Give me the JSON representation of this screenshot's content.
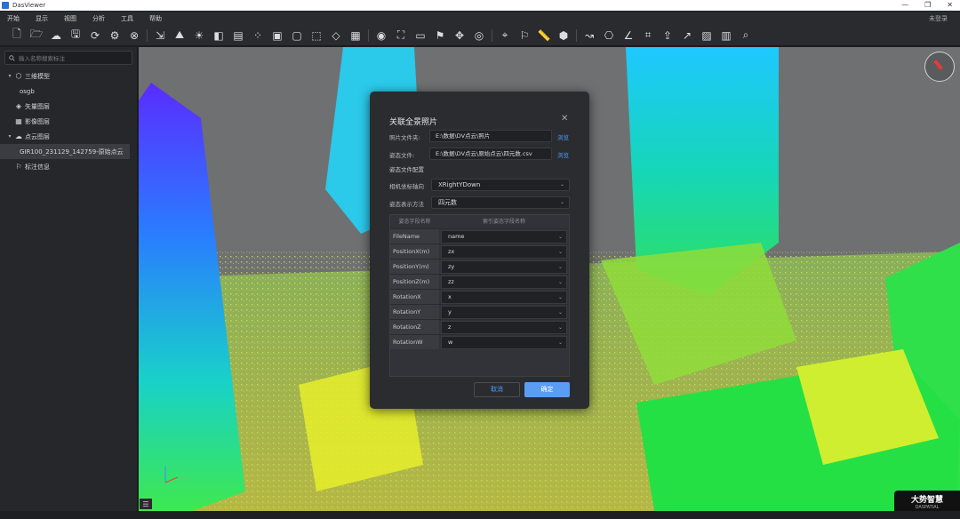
{
  "window": {
    "title": "DasViewer",
    "controls": [
      "—",
      "❐",
      "✕"
    ]
  },
  "menu": {
    "items": [
      "开始",
      "显示",
      "视图",
      "分析",
      "工具",
      "帮助"
    ],
    "login": "未登录"
  },
  "sidebar": {
    "search_placeholder": "输入名称搜索标注",
    "items": [
      {
        "label": "三维模型",
        "icon": "cube-icon",
        "chevron": "▾",
        "indent": 0
      },
      {
        "label": "osgb",
        "icon": "",
        "chevron": "",
        "indent": 1
      },
      {
        "label": "矢量图层",
        "icon": "layers-icon",
        "chevron": "",
        "indent": 0
      },
      {
        "label": "影像图层",
        "icon": "map-icon",
        "chevron": "",
        "indent": 0
      },
      {
        "label": "点云图层",
        "icon": "cloud-icon",
        "chevron": "▾",
        "indent": 0
      },
      {
        "label": "GIR100_231129_142759-原始点云",
        "icon": "",
        "chevron": "",
        "indent": 1,
        "selected": true
      },
      {
        "label": "标注信息",
        "icon": "flag-icon",
        "chevron": "",
        "indent": 0
      }
    ]
  },
  "toolbar": {
    "groups": [
      [
        "new-file-icon",
        "open-folder-icon",
        "cloud-icon",
        "save-icon",
        "refresh-icon",
        "settings-icon",
        "close-circle-icon"
      ],
      [
        "import-icon",
        "terrain-icon",
        "light-icon",
        "contrast-icon",
        "layer-toggle-icon",
        "points-icon",
        "box-solid-icon",
        "box-outline-icon",
        "box-wire-icon",
        "box-tilt-icon",
        "grid-box-icon"
      ],
      [
        "eye-icon",
        "frame-icon",
        "screen-icon",
        "flag-toolbar-icon",
        "move-icon",
        "view-icon"
      ],
      [
        "pin-icon",
        "flag-line-icon",
        "ruler-icon",
        "cube-measure-icon"
      ],
      [
        "route-icon",
        "camera-icon",
        "angle-icon",
        "crop-icon",
        "export-icon",
        "chart-icon",
        "image-icon",
        "building-icon",
        "search-icon"
      ]
    ],
    "glyphs": {
      "new-file-icon": "🗋",
      "open-folder-icon": "🗁",
      "cloud-icon": "☁",
      "save-icon": "🖫",
      "refresh-icon": "⟳",
      "settings-icon": "⚙",
      "close-circle-icon": "⊗",
      "import-icon": "⇲",
      "terrain-icon": "⛰",
      "light-icon": "☀",
      "contrast-icon": "◧",
      "layer-toggle-icon": "▤",
      "points-icon": "⁘",
      "box-solid-icon": "▣",
      "box-outline-icon": "▢",
      "box-wire-icon": "⬚",
      "box-tilt-icon": "◇",
      "grid-box-icon": "▦",
      "eye-icon": "◉",
      "frame-icon": "⛶",
      "screen-icon": "▭",
      "flag-toolbar-icon": "⚑",
      "move-icon": "✥",
      "view-icon": "◎",
      "pin-icon": "⌖",
      "flag-line-icon": "⚐",
      "ruler-icon": "📏",
      "cube-measure-icon": "⬢",
      "route-icon": "↝",
      "camera-icon": "⎔",
      "angle-icon": "∠",
      "crop-icon": "⌗",
      "export-icon": "⇪",
      "chart-icon": "↗",
      "image-icon": "▨",
      "building-icon": "▥",
      "search-icon": "⌕"
    }
  },
  "dialog": {
    "title": "关联全景照片",
    "photo_folder_label": "照片文件夹:",
    "photo_folder_value": "E:\\数据\\DV点云\\照片",
    "pose_file_label": "姿态文件:",
    "pose_file_value": "E:\\数据\\DV点云\\原始点云\\四元数.csv",
    "browse_label": "浏览",
    "config_label": "姿态文件配置",
    "camera_axis_label": "相机坐标轴向",
    "camera_axis_value": "XRightYDown",
    "pose_method_label": "姿态表示方法",
    "pose_method_value": "四元数",
    "table": {
      "headers": [
        "姿态字段名称",
        "索引姿态字段名称"
      ],
      "rows": [
        {
          "name": "FileName",
          "value": "name"
        },
        {
          "name": "PositionX(m)",
          "value": "zx"
        },
        {
          "name": "PositionY(m)",
          "value": "zy"
        },
        {
          "name": "PositionZ(m)",
          "value": "zz"
        },
        {
          "name": "RotationX",
          "value": "x"
        },
        {
          "name": "RotationY",
          "value": "y"
        },
        {
          "name": "RotationZ",
          "value": "z"
        },
        {
          "name": "RotationW",
          "value": "w"
        }
      ]
    },
    "cancel_label": "取消",
    "ok_label": "确定"
  },
  "logo": {
    "name": "大势智慧",
    "sub": "DASPATIAL"
  },
  "colors": {
    "accent": "#5b9cf4",
    "link": "#4d9bff",
    "panel": "#2b2c30"
  }
}
